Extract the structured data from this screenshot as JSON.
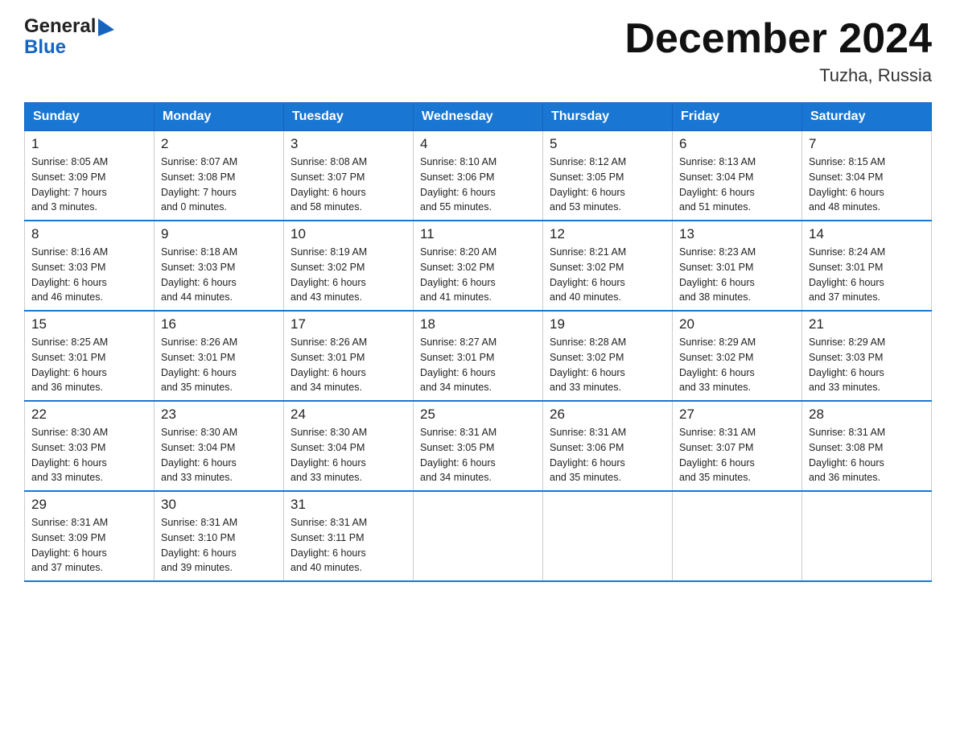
{
  "logo": {
    "line1": "General",
    "line2": "Blue",
    "triangle_color": "#1565c0"
  },
  "title": "December 2024",
  "location": "Tuzha, Russia",
  "days_of_week": [
    "Sunday",
    "Monday",
    "Tuesday",
    "Wednesday",
    "Thursday",
    "Friday",
    "Saturday"
  ],
  "weeks": [
    [
      {
        "day": "1",
        "info": "Sunrise: 8:05 AM\nSunset: 3:09 PM\nDaylight: 7 hours\nand 3 minutes."
      },
      {
        "day": "2",
        "info": "Sunrise: 8:07 AM\nSunset: 3:08 PM\nDaylight: 7 hours\nand 0 minutes."
      },
      {
        "day": "3",
        "info": "Sunrise: 8:08 AM\nSunset: 3:07 PM\nDaylight: 6 hours\nand 58 minutes."
      },
      {
        "day": "4",
        "info": "Sunrise: 8:10 AM\nSunset: 3:06 PM\nDaylight: 6 hours\nand 55 minutes."
      },
      {
        "day": "5",
        "info": "Sunrise: 8:12 AM\nSunset: 3:05 PM\nDaylight: 6 hours\nand 53 minutes."
      },
      {
        "day": "6",
        "info": "Sunrise: 8:13 AM\nSunset: 3:04 PM\nDaylight: 6 hours\nand 51 minutes."
      },
      {
        "day": "7",
        "info": "Sunrise: 8:15 AM\nSunset: 3:04 PM\nDaylight: 6 hours\nand 48 minutes."
      }
    ],
    [
      {
        "day": "8",
        "info": "Sunrise: 8:16 AM\nSunset: 3:03 PM\nDaylight: 6 hours\nand 46 minutes."
      },
      {
        "day": "9",
        "info": "Sunrise: 8:18 AM\nSunset: 3:03 PM\nDaylight: 6 hours\nand 44 minutes."
      },
      {
        "day": "10",
        "info": "Sunrise: 8:19 AM\nSunset: 3:02 PM\nDaylight: 6 hours\nand 43 minutes."
      },
      {
        "day": "11",
        "info": "Sunrise: 8:20 AM\nSunset: 3:02 PM\nDaylight: 6 hours\nand 41 minutes."
      },
      {
        "day": "12",
        "info": "Sunrise: 8:21 AM\nSunset: 3:02 PM\nDaylight: 6 hours\nand 40 minutes."
      },
      {
        "day": "13",
        "info": "Sunrise: 8:23 AM\nSunset: 3:01 PM\nDaylight: 6 hours\nand 38 minutes."
      },
      {
        "day": "14",
        "info": "Sunrise: 8:24 AM\nSunset: 3:01 PM\nDaylight: 6 hours\nand 37 minutes."
      }
    ],
    [
      {
        "day": "15",
        "info": "Sunrise: 8:25 AM\nSunset: 3:01 PM\nDaylight: 6 hours\nand 36 minutes."
      },
      {
        "day": "16",
        "info": "Sunrise: 8:26 AM\nSunset: 3:01 PM\nDaylight: 6 hours\nand 35 minutes."
      },
      {
        "day": "17",
        "info": "Sunrise: 8:26 AM\nSunset: 3:01 PM\nDaylight: 6 hours\nand 34 minutes."
      },
      {
        "day": "18",
        "info": "Sunrise: 8:27 AM\nSunset: 3:01 PM\nDaylight: 6 hours\nand 34 minutes."
      },
      {
        "day": "19",
        "info": "Sunrise: 8:28 AM\nSunset: 3:02 PM\nDaylight: 6 hours\nand 33 minutes."
      },
      {
        "day": "20",
        "info": "Sunrise: 8:29 AM\nSunset: 3:02 PM\nDaylight: 6 hours\nand 33 minutes."
      },
      {
        "day": "21",
        "info": "Sunrise: 8:29 AM\nSunset: 3:03 PM\nDaylight: 6 hours\nand 33 minutes."
      }
    ],
    [
      {
        "day": "22",
        "info": "Sunrise: 8:30 AM\nSunset: 3:03 PM\nDaylight: 6 hours\nand 33 minutes."
      },
      {
        "day": "23",
        "info": "Sunrise: 8:30 AM\nSunset: 3:04 PM\nDaylight: 6 hours\nand 33 minutes."
      },
      {
        "day": "24",
        "info": "Sunrise: 8:30 AM\nSunset: 3:04 PM\nDaylight: 6 hours\nand 33 minutes."
      },
      {
        "day": "25",
        "info": "Sunrise: 8:31 AM\nSunset: 3:05 PM\nDaylight: 6 hours\nand 34 minutes."
      },
      {
        "day": "26",
        "info": "Sunrise: 8:31 AM\nSunset: 3:06 PM\nDaylight: 6 hours\nand 35 minutes."
      },
      {
        "day": "27",
        "info": "Sunrise: 8:31 AM\nSunset: 3:07 PM\nDaylight: 6 hours\nand 35 minutes."
      },
      {
        "day": "28",
        "info": "Sunrise: 8:31 AM\nSunset: 3:08 PM\nDaylight: 6 hours\nand 36 minutes."
      }
    ],
    [
      {
        "day": "29",
        "info": "Sunrise: 8:31 AM\nSunset: 3:09 PM\nDaylight: 6 hours\nand 37 minutes."
      },
      {
        "day": "30",
        "info": "Sunrise: 8:31 AM\nSunset: 3:10 PM\nDaylight: 6 hours\nand 39 minutes."
      },
      {
        "day": "31",
        "info": "Sunrise: 8:31 AM\nSunset: 3:11 PM\nDaylight: 6 hours\nand 40 minutes."
      },
      {
        "day": "",
        "info": ""
      },
      {
        "day": "",
        "info": ""
      },
      {
        "day": "",
        "info": ""
      },
      {
        "day": "",
        "info": ""
      }
    ]
  ]
}
